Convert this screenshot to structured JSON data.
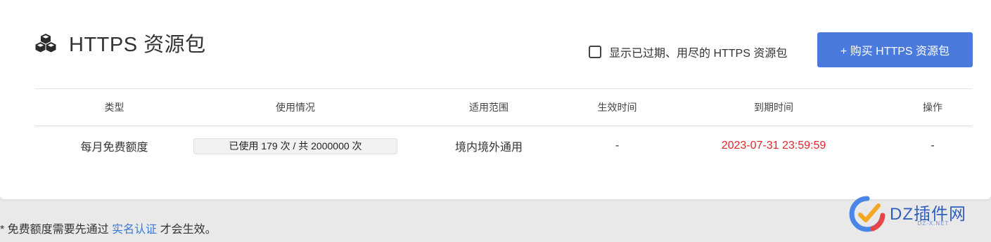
{
  "header": {
    "title": "HTTPS 资源包",
    "icon": "cubes-icon"
  },
  "filter": {
    "show_expired_label": "显示已过期、用尽的 HTTPS 资源包",
    "checked": false
  },
  "actions": {
    "buy_label": "+ 购买 HTTPS 资源包",
    "accent_color": "#4a7bdc"
  },
  "table": {
    "columns": [
      "类型",
      "使用情况",
      "适用范围",
      "生效时间",
      "到期时间",
      "操作"
    ],
    "rows": [
      {
        "type": "每月免费额度",
        "usage_text": "已使用 179 次 / 共 2000000 次",
        "usage_fraction": 8.95e-05,
        "scope": "境内境外通用",
        "start": "-",
        "expire": "2023-07-31 23:59:59",
        "action": "-"
      }
    ]
  },
  "footer": {
    "note_prefix": "* 免费额度需要先通过 ",
    "note_link": "实名认证",
    "note_suffix": " 才会生效。"
  },
  "watermark": {
    "name": "DZ插件网",
    "sub": "DZ-X.NET"
  },
  "colors": {
    "expire": "#e4262b",
    "link": "#3a78d8"
  }
}
